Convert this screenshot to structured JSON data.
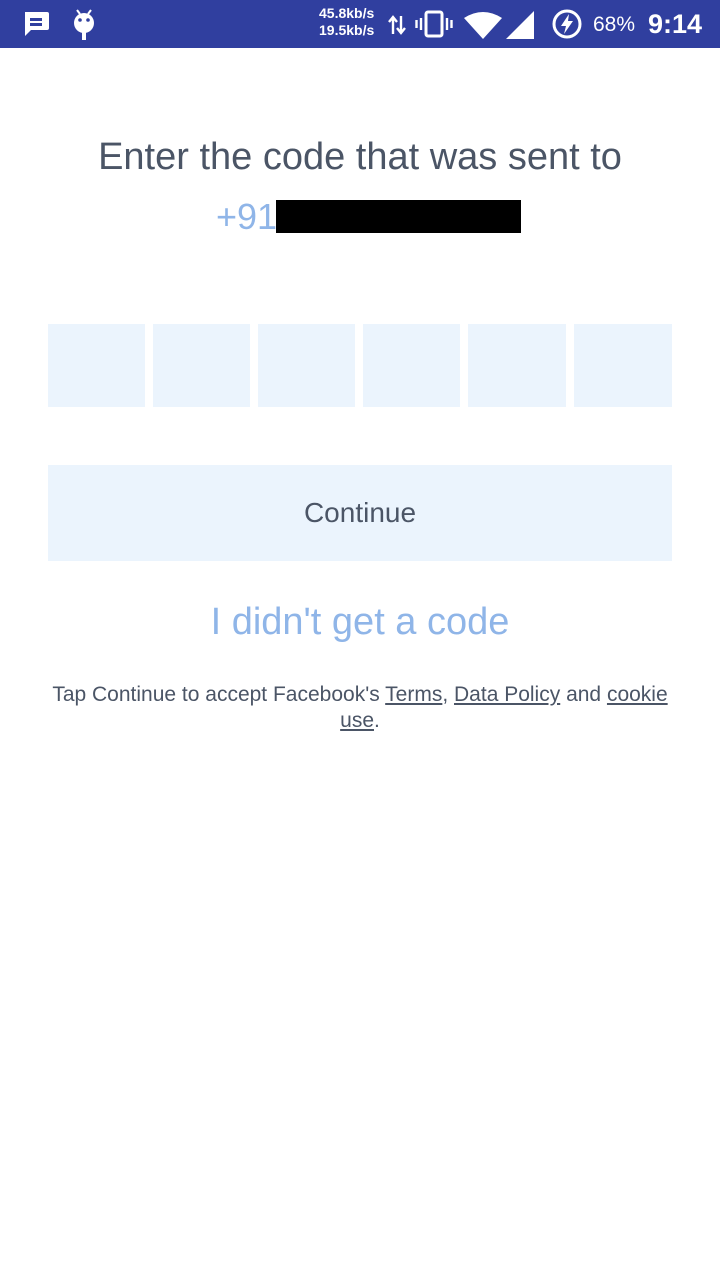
{
  "status_bar": {
    "icons": [
      "message-icon",
      "android-debug-icon",
      "data-transfer-icon",
      "vibrate-icon",
      "wifi-icon",
      "cell-signal-icon",
      "battery-charging-icon"
    ],
    "net_speed_down": "45.8kb/s",
    "net_speed_up": "19.5kb/s",
    "battery_percent": "68%",
    "time": "9:14",
    "bar_color": "#303f9f"
  },
  "verification": {
    "heading": "Enter the code that was sent to",
    "phone_prefix": "+91",
    "code_digits": [
      "",
      "",
      "",
      "",
      "",
      ""
    ],
    "continue_label": "Continue",
    "no_code_link": "I didn't get a code"
  },
  "legal": {
    "prefix": "Tap Continue to accept Facebook's ",
    "terms_link": "Terms",
    "sep1": ", ",
    "data_policy_link": "Data Policy",
    "sep2": " and ",
    "cookie_link": "cookie use",
    "suffix": "."
  },
  "colors": {
    "text": "#4b5566",
    "accent_light": "#8fb5e8",
    "field_background": "#ebf4fd"
  }
}
